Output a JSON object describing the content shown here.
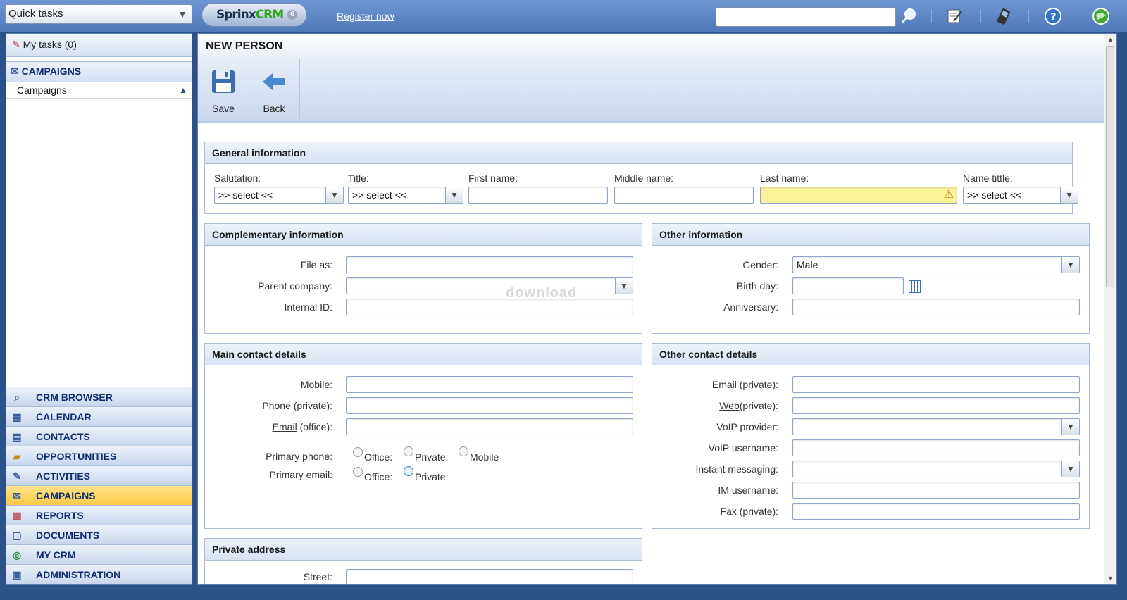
{
  "topbar": {
    "quick_tasks": "Quick tasks",
    "logo_sprinx": "Sprinx",
    "logo_crm": "CRM",
    "logo_version": "6",
    "register_link": "Register now",
    "search_value": ""
  },
  "sidebar": {
    "mytasks_link": "My tasks",
    "mytasks_count": "(0)",
    "section_title": "CAMPAIGNS",
    "section_item": "Campaigns",
    "nav": [
      {
        "label": "CRM BROWSER",
        "icon": "magnifier-icon"
      },
      {
        "label": "CALENDAR",
        "icon": "calendar-icon"
      },
      {
        "label": "CONTACTS",
        "icon": "contact-card-icon"
      },
      {
        "label": "OPPORTUNITIES",
        "icon": "briefcase-icon"
      },
      {
        "label": "ACTIVITIES",
        "icon": "activity-icon"
      },
      {
        "label": "CAMPAIGNS",
        "icon": "campaign-icon"
      },
      {
        "label": "REPORTS",
        "icon": "reports-icon"
      },
      {
        "label": "DOCUMENTS",
        "icon": "document-icon"
      },
      {
        "label": "MY CRM",
        "icon": "target-icon"
      },
      {
        "label": "ADMINISTRATION",
        "icon": "lock-icon"
      }
    ],
    "active_nav": "CAMPAIGNS"
  },
  "main": {
    "title": "NEW PERSON",
    "toolbar": {
      "save": "Save",
      "back": "Back"
    },
    "general": {
      "heading": "General information",
      "salutation_label": "Salutation:",
      "salutation_value": ">> select <<",
      "title_label": "Title:",
      "title_value": ">> select <<",
      "first_name_label": "First name:",
      "middle_name_label": "Middle name:",
      "last_name_label": "Last name:",
      "name_title_label": "Name tittle:",
      "name_title_value": ">> select <<"
    },
    "complementary": {
      "heading": "Complementary information",
      "file_as": "File as:",
      "parent_company": "Parent company:",
      "internal_id": "Internal ID:"
    },
    "other_info": {
      "heading": "Other information",
      "gender_label": "Gender:",
      "gender_value": "Male",
      "birthday_label": "Birth day:",
      "anniversary_label": "Anniversary:"
    },
    "main_contact": {
      "heading": "Main contact details",
      "mobile": "Mobile:",
      "phone_private": "Phone (private):",
      "email_link": "Email",
      "email_office_suffix": " (office):",
      "primary_phone": "Primary phone:",
      "primary_email": "Primary email:",
      "opt_office": "Office:",
      "opt_private": "Private:",
      "opt_mobile": "Mobile"
    },
    "other_contact": {
      "heading": "Other contact details",
      "email_link": "Email",
      "email_private_suffix": " (private):",
      "web_link": "Web",
      "web_private_suffix": "(private):",
      "voip_provider": "VoIP provider:",
      "voip_username": "VoIP username:",
      "instant_messaging": "Instant messaging:",
      "im_username": "IM username:",
      "fax_private": "Fax (private):"
    },
    "private_address": {
      "heading": "Private address",
      "street_label": "Street:"
    },
    "watermark": "download"
  },
  "colors": {
    "accent": "#0d2f70",
    "active_nav": "#fcc948",
    "warning_field": "#fbf29a"
  }
}
